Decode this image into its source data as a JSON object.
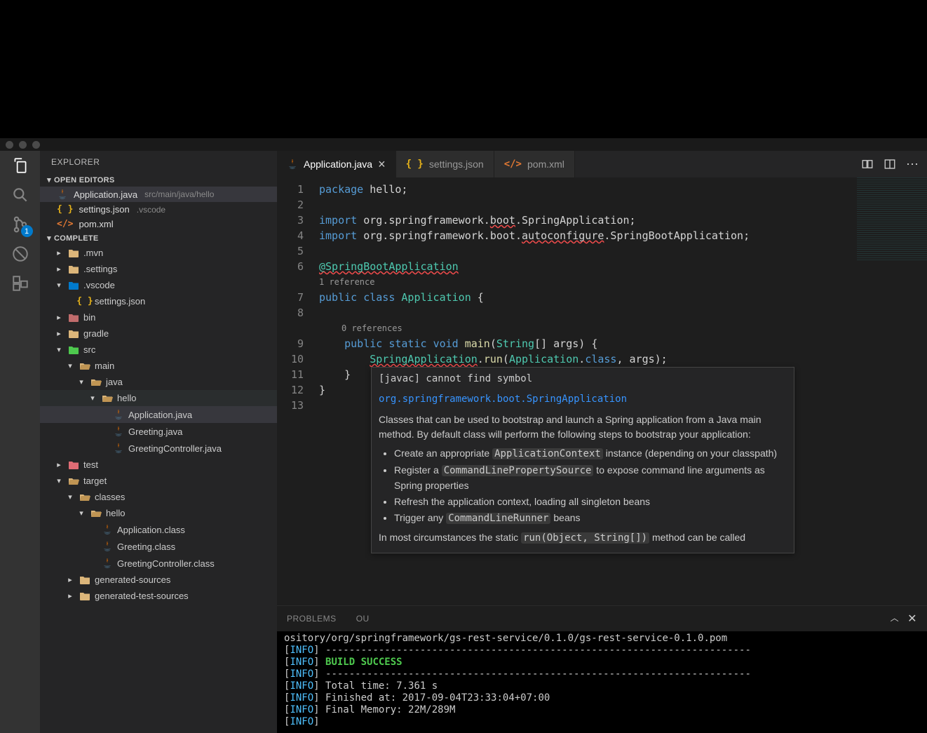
{
  "sidebar": {
    "title": "EXPLORER",
    "sections": {
      "openEditors": {
        "label": "OPEN EDITORS",
        "items": [
          {
            "icon": "java",
            "name": "Application.java",
            "path": "src/main/java/hello",
            "active": true
          },
          {
            "icon": "json",
            "name": "settings.json",
            "path": ".vscode",
            "active": false
          },
          {
            "icon": "xml",
            "name": "pom.xml",
            "path": "",
            "active": false
          }
        ]
      },
      "project": {
        "label": "COMPLETE"
      }
    }
  },
  "tree": [
    {
      "indent": 0,
      "twisty": "▸",
      "icon": "folder",
      "label": ".mvn"
    },
    {
      "indent": 0,
      "twisty": "▸",
      "icon": "folder",
      "label": ".settings"
    },
    {
      "indent": 0,
      "twisty": "▾",
      "icon": "folder-vscode",
      "label": ".vscode"
    },
    {
      "indent": 1,
      "twisty": "",
      "icon": "json",
      "label": "settings.json"
    },
    {
      "indent": 0,
      "twisty": "▸",
      "icon": "folder-bin",
      "label": "bin"
    },
    {
      "indent": 0,
      "twisty": "▸",
      "icon": "folder",
      "label": "gradle"
    },
    {
      "indent": 0,
      "twisty": "▾",
      "icon": "folder-src",
      "label": "src"
    },
    {
      "indent": 1,
      "twisty": "▾",
      "icon": "folder-open",
      "label": "main"
    },
    {
      "indent": 2,
      "twisty": "▾",
      "icon": "folder-open",
      "label": "java"
    },
    {
      "indent": 3,
      "twisty": "▾",
      "icon": "folder-open",
      "label": "hello",
      "selected": false,
      "highlight": true
    },
    {
      "indent": 4,
      "twisty": "",
      "icon": "java",
      "label": "Application.java",
      "selected": true
    },
    {
      "indent": 4,
      "twisty": "",
      "icon": "java",
      "label": "Greeting.java"
    },
    {
      "indent": 4,
      "twisty": "",
      "icon": "java",
      "label": "GreetingController.java"
    },
    {
      "indent": 0,
      "twisty": "▸",
      "icon": "folder-test",
      "label": "test"
    },
    {
      "indent": 0,
      "twisty": "▾",
      "icon": "folder-open",
      "label": "target"
    },
    {
      "indent": 1,
      "twisty": "▾",
      "icon": "folder-open",
      "label": "classes"
    },
    {
      "indent": 2,
      "twisty": "▾",
      "icon": "folder-open",
      "label": "hello"
    },
    {
      "indent": 3,
      "twisty": "",
      "icon": "java",
      "label": "Application.class"
    },
    {
      "indent": 3,
      "twisty": "",
      "icon": "java",
      "label": "Greeting.class"
    },
    {
      "indent": 3,
      "twisty": "",
      "icon": "java",
      "label": "GreetingController.class"
    },
    {
      "indent": 1,
      "twisty": "▸",
      "icon": "folder",
      "label": "generated-sources"
    },
    {
      "indent": 1,
      "twisty": "▸",
      "icon": "folder",
      "label": "generated-test-sources"
    }
  ],
  "tabs": [
    {
      "icon": "java",
      "label": "Application.java",
      "active": true,
      "close": true
    },
    {
      "icon": "json",
      "label": "settings.json",
      "active": false
    },
    {
      "icon": "xml",
      "label": "pom.xml",
      "active": false
    }
  ],
  "code": {
    "lines": [
      "1",
      "2",
      "3",
      "4",
      "5",
      "6",
      "",
      "7",
      "8",
      "",
      "9",
      "10",
      "11",
      "12",
      "13"
    ],
    "codelens1": "1 reference",
    "codelens2": "0 references",
    "l1_kw": "package",
    "l1_rest": " hello;",
    "l3_kw": "import",
    "l3_a": " org.springframework.",
    "l3_b": "boot",
    "l3_c": ".SpringApplication;",
    "l4_kw": "import",
    "l4_a": " org.springframework.boot.",
    "l4_b": "autoconfigure",
    "l4_c": ".SpringBootApplication;",
    "l6": "@SpringBootApplication",
    "l7_a": "public",
    "l7_b": " class ",
    "l7_c": "Application",
    "l7_d": " {",
    "l9_a": "public",
    "l9_b": " static ",
    "l9_c": "void",
    "l9_d": " main",
    "l9_e": "(",
    "l9_f": "String",
    "l9_g": "[] args) {",
    "l10_a": "SpringApplication",
    "l10_b": ".",
    "l10_c": "run",
    "l10_d": "(",
    "l10_e": "Application",
    "l10_f": ".",
    "l10_g": "class",
    "l10_h": ", args);",
    "l11": "    }",
    "l12": "}"
  },
  "hover": {
    "err": "[javac] cannot find symbol",
    "link": "org.springframework.boot.SpringApplication",
    "para": "Classes that can be used to bootstrap and launch a Spring application from a Java main method. By default class will perform the following steps to bootstrap your application:",
    "li1_a": "Create an appropriate ",
    "li1_chip": "ApplicationContext",
    "li1_b": " instance (depending on your classpath)",
    "li2_a": "Register a ",
    "li2_chip": "CommandLinePropertySource",
    "li2_b": " to expose command line arguments as Spring properties",
    "li3": "Refresh the application context, loading all singleton beans",
    "li4_a": "Trigger any ",
    "li4_chip": "CommandLineRunner",
    "li4_b": " beans",
    "foot_a": "In most circumstances the static ",
    "foot_chip": "run(Object, String[])",
    "foot_b": " method can be called"
  },
  "panel": {
    "tabs": {
      "problems": "PROBLEMS",
      "output": "OU"
    }
  },
  "terminal": {
    "l0": "ository/org/springframework/gs-rest-service/0.1.0/gs-rest-service-0.1.0.pom",
    "dashes": " ------------------------------------------------------------------------",
    "success": " BUILD SUCCESS",
    "time": " Total time: 7.361 s",
    "finished": " Finished at: 2017-09-04T23:33:04+07:00",
    "memory": " Final Memory: 22M/289M",
    "tag": "INFO",
    "lb": "[",
    "rb": "]"
  },
  "scm_badge": "1"
}
